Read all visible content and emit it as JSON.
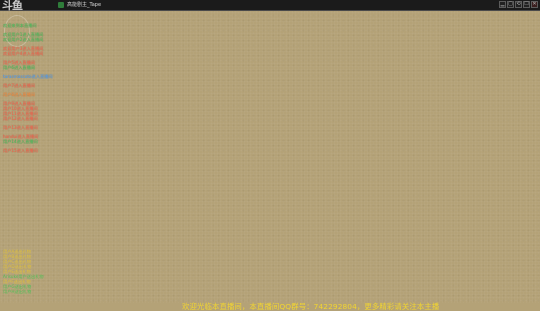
{
  "window": {
    "title": "高能剧主_Tape",
    "logo_text": "斗鱼",
    "controls": [
      "▁",
      "▢",
      "⟲",
      "☐",
      "✕"
    ]
  },
  "chat": {
    "messages": [
      {
        "text": "欢迎来到本直播间",
        "color": "green"
      },
      {
        "text": "",
        "color": "spacer"
      },
      {
        "text": "欢迎用户1进入直播间",
        "color": "green"
      },
      {
        "text": "欢迎用户2进入直播间",
        "color": "green"
      },
      {
        "text": "",
        "color": "spacer"
      },
      {
        "text": "欢迎用户3进入直播间",
        "color": "red"
      },
      {
        "text": "欢迎用户4进入直播间",
        "color": "red"
      },
      {
        "text": "",
        "color": "spacer"
      },
      {
        "text": "用户5进入直播间",
        "color": "red"
      },
      {
        "text": "用户6进入直播间",
        "color": "green"
      },
      {
        "text": "",
        "color": "spacer"
      },
      {
        "text": "tarasmascoto进入直播间",
        "color": "blue"
      },
      {
        "text": "",
        "color": "spacer"
      },
      {
        "text": "用户7进入直播间",
        "color": "red"
      },
      {
        "text": "",
        "color": "spacer"
      },
      {
        "text": "用户8进入直播间",
        "color": "orange"
      },
      {
        "text": "",
        "color": "spacer"
      },
      {
        "text": "用户9进入直播间",
        "color": "red"
      },
      {
        "text": "用户10进入直播间",
        "color": "red"
      },
      {
        "text": "用户11进入直播间",
        "color": "red"
      },
      {
        "text": "用户12进入直播间",
        "color": "red"
      },
      {
        "text": "",
        "color": "spacer"
      },
      {
        "text": "用户13进入直播间",
        "color": "red"
      },
      {
        "text": "",
        "color": "spacer"
      },
      {
        "text": "handui进入直播间",
        "color": "red"
      },
      {
        "text": "用户14进入直播间",
        "color": "green"
      },
      {
        "text": "",
        "color": "spacer"
      },
      {
        "text": "用户15进入直播间",
        "color": "red"
      }
    ]
  },
  "bottom_feed": {
    "items": [
      {
        "text": "用户A送出礼物",
        "color": "yellow"
      },
      {
        "text": "用户B送出礼物",
        "color": "yellow"
      },
      {
        "text": "用户C送出礼物",
        "color": "yellow"
      },
      {
        "text": "用户D送出礼物",
        "color": "yellow"
      },
      {
        "text": "",
        "color": "yellow"
      },
      {
        "text": "用户E送出礼物",
        "color": "yellow"
      },
      {
        "text": "",
        "color": "yellow"
      },
      {
        "text": "Arisuke用户送出礼物",
        "color": "green"
      },
      {
        "text": "用户F送出礼物",
        "color": "yellow"
      },
      {
        "text": "用户G送出礼物",
        "color": "green"
      },
      {
        "text": "用户H送出礼物",
        "color": "green"
      }
    ]
  },
  "footer": {
    "notice": "欢迎光临本直播间，本直播间QQ群号：742292804，更多精彩请关注本主播"
  },
  "colors": {
    "red": "#ff5e4a",
    "green": "#44c25a",
    "blue": "#4a9fff",
    "orange": "#ff8a3a",
    "yellow": "#f2d530",
    "background": "#b4a277",
    "titlebar": "#1b1b1b"
  }
}
